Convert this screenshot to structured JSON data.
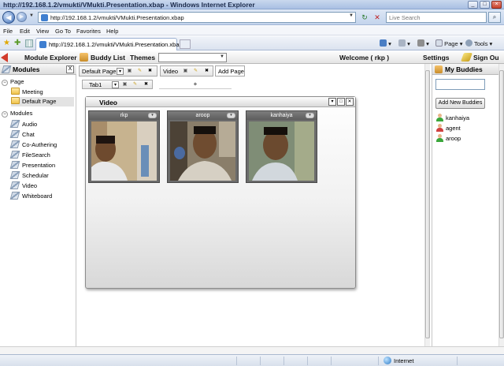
{
  "browser": {
    "title": "http://192.168.1.2/vmukti/VMukti.Presentation.xbap - Windows Internet Explorer",
    "address": "http://192.168.1.2/vmukti/VMukti.Presentation.xbap",
    "search_placeholder": "Live Search",
    "menu": [
      "File",
      "Edit",
      "View",
      "Go To",
      "Favorites",
      "Help"
    ],
    "tab_title": "http://192.168.1.2/vmukti/VMukti.Presentation.xbap",
    "tools": {
      "page": "Page",
      "tools": "Tools"
    },
    "status": "Internet"
  },
  "app_header": {
    "module_explorer": "Module Explorer",
    "buddy_list": "Buddy List",
    "themes": "Themes",
    "themes_value": "",
    "welcome": "Welcome ( rkp )",
    "settings": "Settings",
    "sign_out": "Sign Ou"
  },
  "modules_panel": {
    "title": "Modules",
    "close": "X",
    "page_group": "Page",
    "pages": [
      "Meeting",
      "Default Page"
    ],
    "modules_group": "Modules",
    "modules": [
      "Audio",
      "Chat",
      "Co-Authering",
      "FileSearch",
      "Presentation",
      "Schedular",
      "Video",
      "Whiteboard"
    ]
  },
  "workspace": {
    "page_tabs": {
      "default_page": "Default Page",
      "video": "Video",
      "add_page": "Add Page"
    },
    "sub_tab": "Tab1",
    "plus": "+",
    "video_window": {
      "title": "Video",
      "cams": [
        "rkp",
        "aroop",
        "kanhaiya"
      ]
    }
  },
  "buddies_panel": {
    "title": "My Buddies",
    "add_button": "Add New Buddies",
    "buddies": [
      {
        "name": "kanhaiya",
        "color": "#3aa63a"
      },
      {
        "name": "agent",
        "color": "#d04040"
      },
      {
        "name": "aroop",
        "color": "#3aa63a"
      }
    ]
  },
  "colors": {
    "accent_red": "#d23b2b",
    "online": "#3aa63a",
    "offline": "#d04040"
  }
}
